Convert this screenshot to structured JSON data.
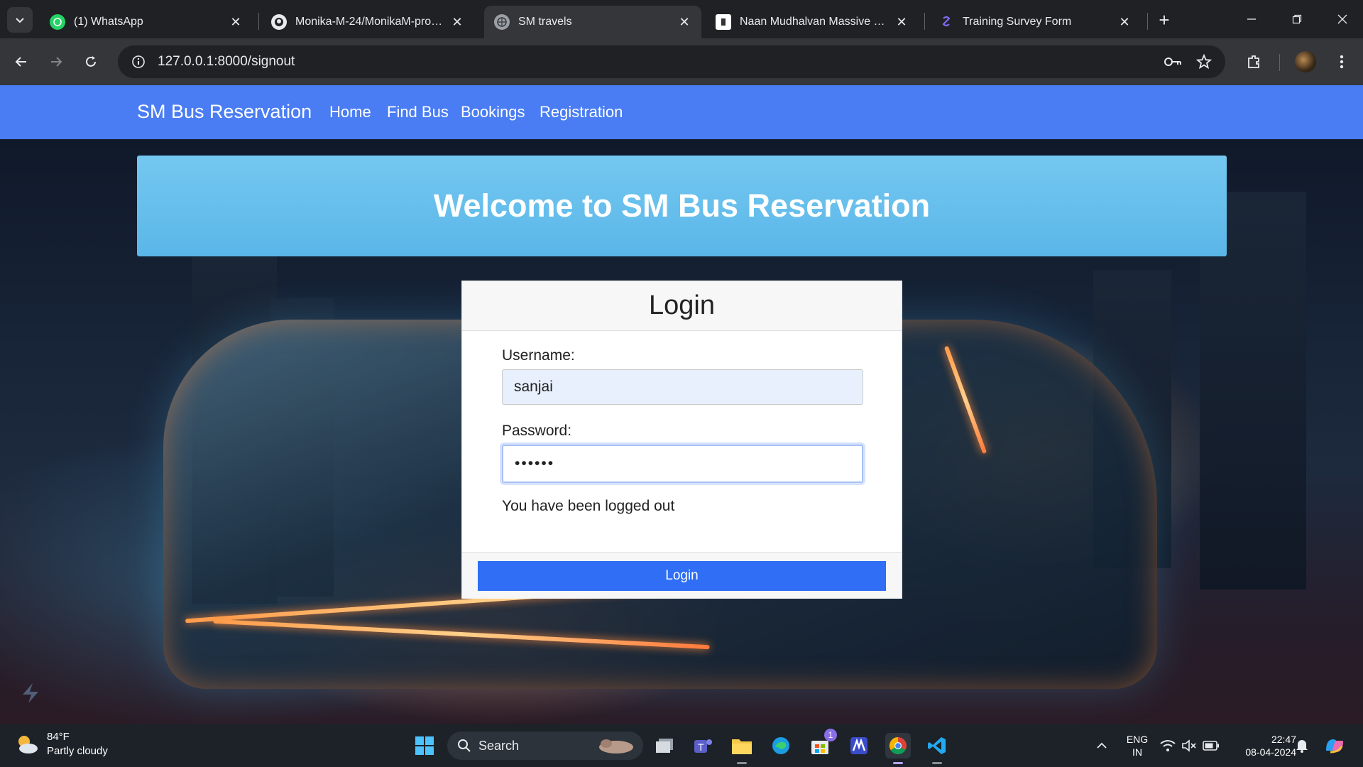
{
  "browser": {
    "tabs": [
      {
        "title": "(1) WhatsApp",
        "active": false
      },
      {
        "title": "Monika-M-24/MonikaM-project",
        "active": false
      },
      {
        "title": "SM travels",
        "active": true
      },
      {
        "title": "Naan Mudhalvan Massive Upskil",
        "active": false
      },
      {
        "title": "Training Survey Form",
        "active": false
      }
    ],
    "url": "127.0.0.1:8000/signout"
  },
  "navbar": {
    "brand": "SM Bus Reservation",
    "links": [
      "Home",
      "Find Bus",
      "Bookings",
      "Registration"
    ]
  },
  "hero": {
    "title": "Welcome to SM Bus Reservation"
  },
  "login": {
    "title": "Login",
    "username_label": "Username:",
    "username_value": "sanjai",
    "password_label": "Password:",
    "password_masked": "••••••",
    "message": "You have been logged out",
    "button_label": "Login"
  },
  "taskbar": {
    "weather_temp": "84°F",
    "weather_desc": "Partly cloudy",
    "search_label": "Search",
    "lang_top": "ENG",
    "lang_bottom": "IN",
    "time": "22:47",
    "date": "08-04-2024",
    "store_badge": "1"
  },
  "colors": {
    "navbar": "#4a7df3",
    "hero": "#5ab6e8",
    "login_button": "#2f6ef5",
    "chrome_dark": "#202124"
  }
}
